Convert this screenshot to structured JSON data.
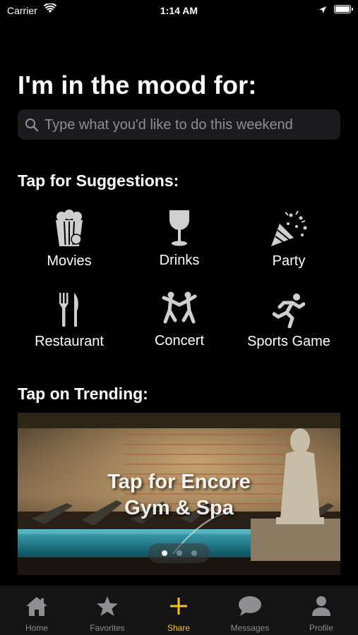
{
  "status": {
    "carrier": "Carrier",
    "time": "1:14 AM",
    "battery_level": 1.0
  },
  "header": {
    "title": "I'm in the mood for:"
  },
  "search": {
    "placeholder": "Type what you'd like to do this weekend",
    "value": ""
  },
  "suggestions": {
    "heading": "Tap for Suggestions:",
    "items": [
      {
        "label": "Movies",
        "icon": "popcorn-icon"
      },
      {
        "label": "Drinks",
        "icon": "wine-glass-icon"
      },
      {
        "label": "Party",
        "icon": "party-popper-icon"
      },
      {
        "label": "Restaurant",
        "icon": "fork-knife-icon"
      },
      {
        "label": "Concert",
        "icon": "dancers-icon"
      },
      {
        "label": "Sports Game",
        "icon": "runner-icon"
      }
    ]
  },
  "trending": {
    "heading": "Tap on Trending:",
    "banner_line1": "Tap for Encore",
    "banner_line2": "Gym & Spa",
    "page_count": 3,
    "current_page": 1
  },
  "tabbar": {
    "accent_color": "#f5c518",
    "items": [
      {
        "label": "Home",
        "icon": "home-icon"
      },
      {
        "label": "Favorites",
        "icon": "star-icon"
      },
      {
        "label": "Share",
        "icon": "plus-icon",
        "active": true
      },
      {
        "label": "Messages",
        "icon": "chat-bubble-icon"
      },
      {
        "label": "Profile",
        "icon": "person-icon"
      }
    ]
  }
}
